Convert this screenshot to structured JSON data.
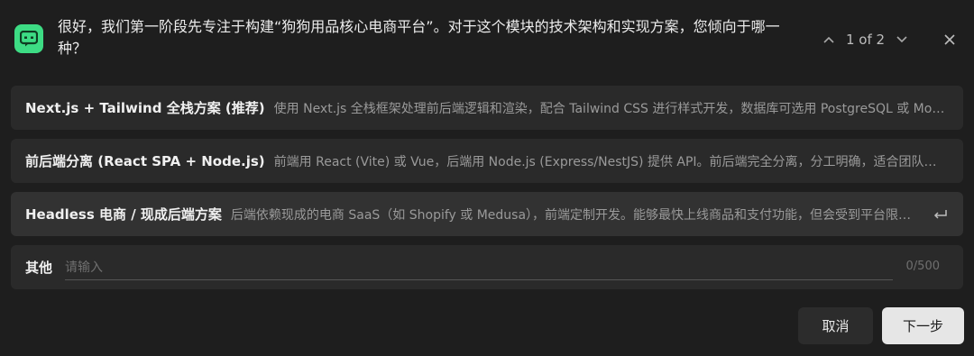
{
  "header": {
    "question": "很好，我们第一阶段先专注于构建“狗狗用品核心电商平台”。对于这个模块的技术架构和实现方案，您倾向于哪一种？",
    "pager_text": "1 of 2",
    "icons": {
      "app": "chat-bubble-icon",
      "prev": "chevron-up-icon",
      "next": "chevron-down-icon",
      "close": "close-icon"
    }
  },
  "options": [
    {
      "title": "Next.js + Tailwind 全栈方案 (推荐)",
      "description": "使用 Next.js 全栈框架处理前后端逻辑和渲染，配合 Tailwind CSS 进行样式开发，数据库可选用 PostgreSQL 或 MongoDB。"
    },
    {
      "title": "前后端分离 (React SPA + Node.js)",
      "description": "前端用 React (Vite) 或 Vue，后端用 Node.js (Express/NestJS) 提供 API。前后端完全分离，分工明确，适合团队协作。"
    },
    {
      "title": "Headless 电商 / 现成后端方案",
      "description": "后端依赖现成的电商 SaaS（如 Shopify 或 Medusa），前端定制开发。能够最快上线商品和支付功能，但会受到平台限制。"
    }
  ],
  "other": {
    "label": "其他",
    "placeholder": "请输入",
    "counter": "0/500"
  },
  "footer": {
    "cancel_label": "取消",
    "next_label": "下一步"
  },
  "colors": {
    "accent": "#3ddc84",
    "background": "#1e1e1e",
    "card": "#2a2a2a"
  }
}
